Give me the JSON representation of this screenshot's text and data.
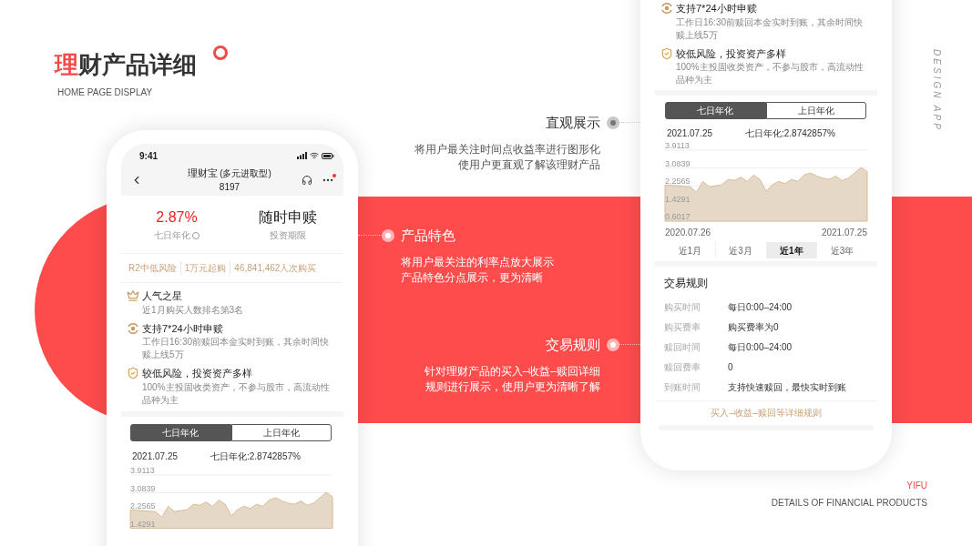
{
  "header": {
    "title_accent": "理",
    "title_rest": "财产品详细",
    "subtitle": "HOME PAGE DISPLAY"
  },
  "side_label": "DESIGN APP",
  "annotations": [
    {
      "title": "直观展示",
      "kind": "on_white",
      "lines": [
        "将用户最关注时间点收益率进行图形化",
        "使用户更直观了解该理财产品"
      ]
    },
    {
      "title": "产品特色",
      "kind": "on_red",
      "lines": [
        "将用户最关注的利率点放大展示",
        "产品特色分点展示，更为清晰"
      ]
    },
    {
      "title": "交易规则",
      "kind": "on_red",
      "lines": [
        "针对理财产品的买入–收益–赎回详细",
        "规则进行展示，使用户更为清晰了解"
      ]
    }
  ],
  "left_phone": {
    "status_time": "9:41",
    "nav_title": "理财宝",
    "nav_subtitle": "(多元进取型)",
    "nav_code": "8197",
    "notification": true,
    "rate": "2.87%",
    "rate_label": "七日年化",
    "term": "随时申赎",
    "term_label": "投资期限",
    "tags": [
      "R2中低风险",
      "1万元起购",
      "46,841,462人次购买"
    ],
    "features": [
      {
        "kind": "crown",
        "title": "人气之星",
        "desc": "近1月购买人数排名第3名"
      },
      {
        "kind": "clock",
        "title": "支持7*24小时申赎",
        "desc": "工作日16:30前赎回本金实时到账，其余时间快赎上线5万"
      },
      {
        "kind": "shield",
        "title": "较低风险，投资资产多样",
        "desc": "100%主投固收类资产，不参与股市，高流动性品种为主"
      }
    ],
    "chart_tabs": [
      {
        "label": "七日年化",
        "selected": true
      },
      {
        "label": "上日年化",
        "selected": false
      }
    ],
    "chart_date": "2021.07.25",
    "chart_reading": "七日年化:2.8742857%",
    "chart_data": {
      "type": "area",
      "ylim": [
        1.4291,
        3.9113
      ],
      "yticks": [
        3.9113,
        3.0839,
        2.2565,
        1.4291
      ],
      "series": [
        {
          "color": "#d9bc98",
          "values": [
            2.28,
            2.27,
            2.25,
            2.22,
            2.2,
            1.95,
            2.45,
            2.2,
            2.25,
            2.3,
            2.55,
            2.5,
            2.65,
            2.45,
            2.75,
            2.55,
            2.0,
            2.3,
            2.45,
            2.35,
            2.55,
            2.45,
            2.75,
            2.85,
            2.7,
            2.6,
            2.55,
            2.7,
            2.5,
            2.6,
            2.85,
            3.1,
            2.9
          ]
        }
      ]
    }
  },
  "right_phone": {
    "features": [
      {
        "kind": "clock",
        "title": "支持7*24小时申赎",
        "desc": "工作日16:30前赎回本金实时到账，其余时间快赎上线5万"
      },
      {
        "kind": "shield",
        "title": "较低风险，投资资产多样",
        "desc": "100%主投固收类资产，不参与股市，高流动性品种为主"
      }
    ],
    "chart_tabs": [
      {
        "label": "七日年化",
        "selected": true
      },
      {
        "label": "上日年化",
        "selected": false
      }
    ],
    "chart_date": "2021.07.25",
    "chart_reading": "七日年化:2.8742857%",
    "chart_data": {
      "type": "area",
      "ylim": [
        0.6017,
        3.9113
      ],
      "yticks": [
        3.9113,
        3.0839,
        2.2565,
        1.4291,
        0.6017
      ],
      "series": [
        {
          "color": "#d9bc98",
          "values": [
            2.28,
            2.27,
            2.25,
            2.22,
            2.2,
            1.95,
            2.45,
            2.2,
            2.25,
            2.3,
            2.55,
            2.5,
            2.65,
            2.45,
            2.75,
            2.55,
            2.0,
            2.3,
            2.45,
            2.35,
            2.55,
            2.45,
            2.75,
            2.85,
            2.7,
            2.6,
            2.55,
            2.7,
            2.5,
            2.6,
            2.85,
            3.1,
            2.9
          ]
        }
      ]
    },
    "axis_dates": [
      "2020.07.26",
      "2021.07.25"
    ],
    "range_tabs": [
      {
        "label": "近1月",
        "selected": false
      },
      {
        "label": "近3月",
        "selected": false
      },
      {
        "label": "近1年",
        "selected": true
      },
      {
        "label": "近3年",
        "selected": false
      }
    ],
    "rules_title": "交易规则",
    "rules": [
      {
        "label": "购买时间",
        "value": "每日0:00–24:00"
      },
      {
        "label": "购买费率",
        "value": "购买费率为0"
      },
      {
        "label": "赎回时间",
        "value": "每日0:00–24:00"
      },
      {
        "label": "赎回费率",
        "value": "0"
      },
      {
        "label": "到账时间",
        "value": "支持快速赎回，最快实时到账"
      }
    ],
    "rules_link": "买入–收益–赎回等详细规则"
  },
  "footer": {
    "brand": "YIFU",
    "caption": "DETAILS OF FINANCIAL PRODUCTS"
  }
}
